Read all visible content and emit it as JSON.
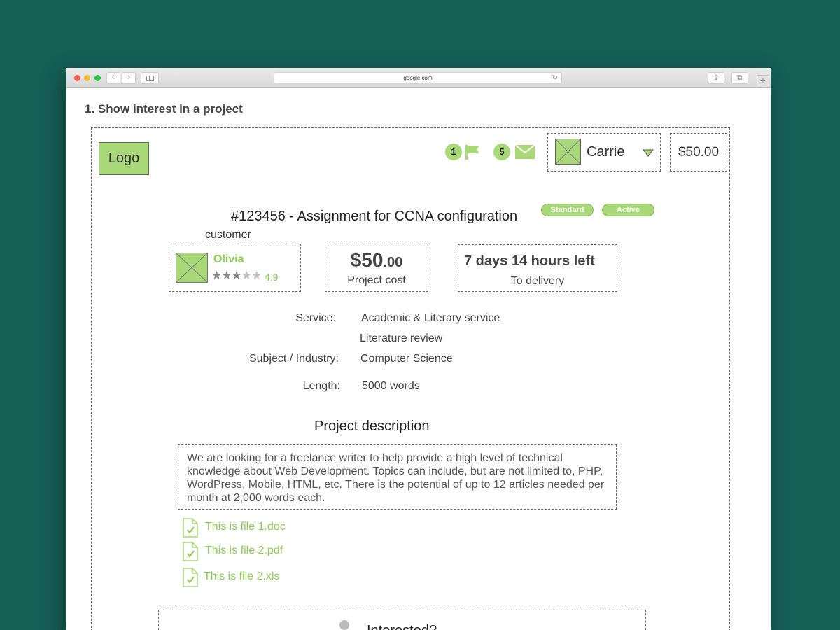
{
  "browser": {
    "url": "google.com",
    "nav_back": "‹",
    "nav_forward": "›",
    "reload_icon": "↻",
    "share_icon": "⇪",
    "tabs_icon": "⧉",
    "new_tab_icon": "+"
  },
  "page": {
    "heading": "1. Show interest in a project"
  },
  "header": {
    "logo": "Logo",
    "notifications_count": "1",
    "messages_count": "5",
    "user_name": "Carrie",
    "balance": "$50.00"
  },
  "project": {
    "title": "#123456 - Assignment for CCNA configuration",
    "badges": [
      "Standard",
      "Active"
    ],
    "customer_label": "customer",
    "customer": {
      "name": "Olivia",
      "rating": "4.9",
      "stars_filled": 3,
      "stars_total": 5
    },
    "cost": {
      "dollars": "$50",
      "cents": ".00",
      "label": "Project cost"
    },
    "deadline": {
      "value": "7 days 14 hours left",
      "label": "To delivery"
    },
    "details": {
      "service_label": "Service:",
      "service_value": "Academic & Literary service",
      "service_value_2": "Literature review",
      "subject_label": "Subject / Industry:",
      "subject_value": "Computer Science",
      "length_label": "Length:",
      "length_value": "5000 words"
    },
    "description_title": "Project description",
    "description": "We are looking for a freelance writer to help provide a high level of technical knowledge about Web Development. Topics can include, but are not limited to, PHP, WordPress, Mobile, HTML, etc. There is the potential of up to 12 articles needed per month at 2,000 words each.",
    "files": [
      "This is file 1.doc",
      "This is file 2.pdf",
      "This is file 2.xls"
    ],
    "interest_prompt": "Interested?"
  },
  "colors": {
    "background": "#155f55",
    "accent_green": "#a8d878",
    "link_green": "#8dcb55"
  }
}
